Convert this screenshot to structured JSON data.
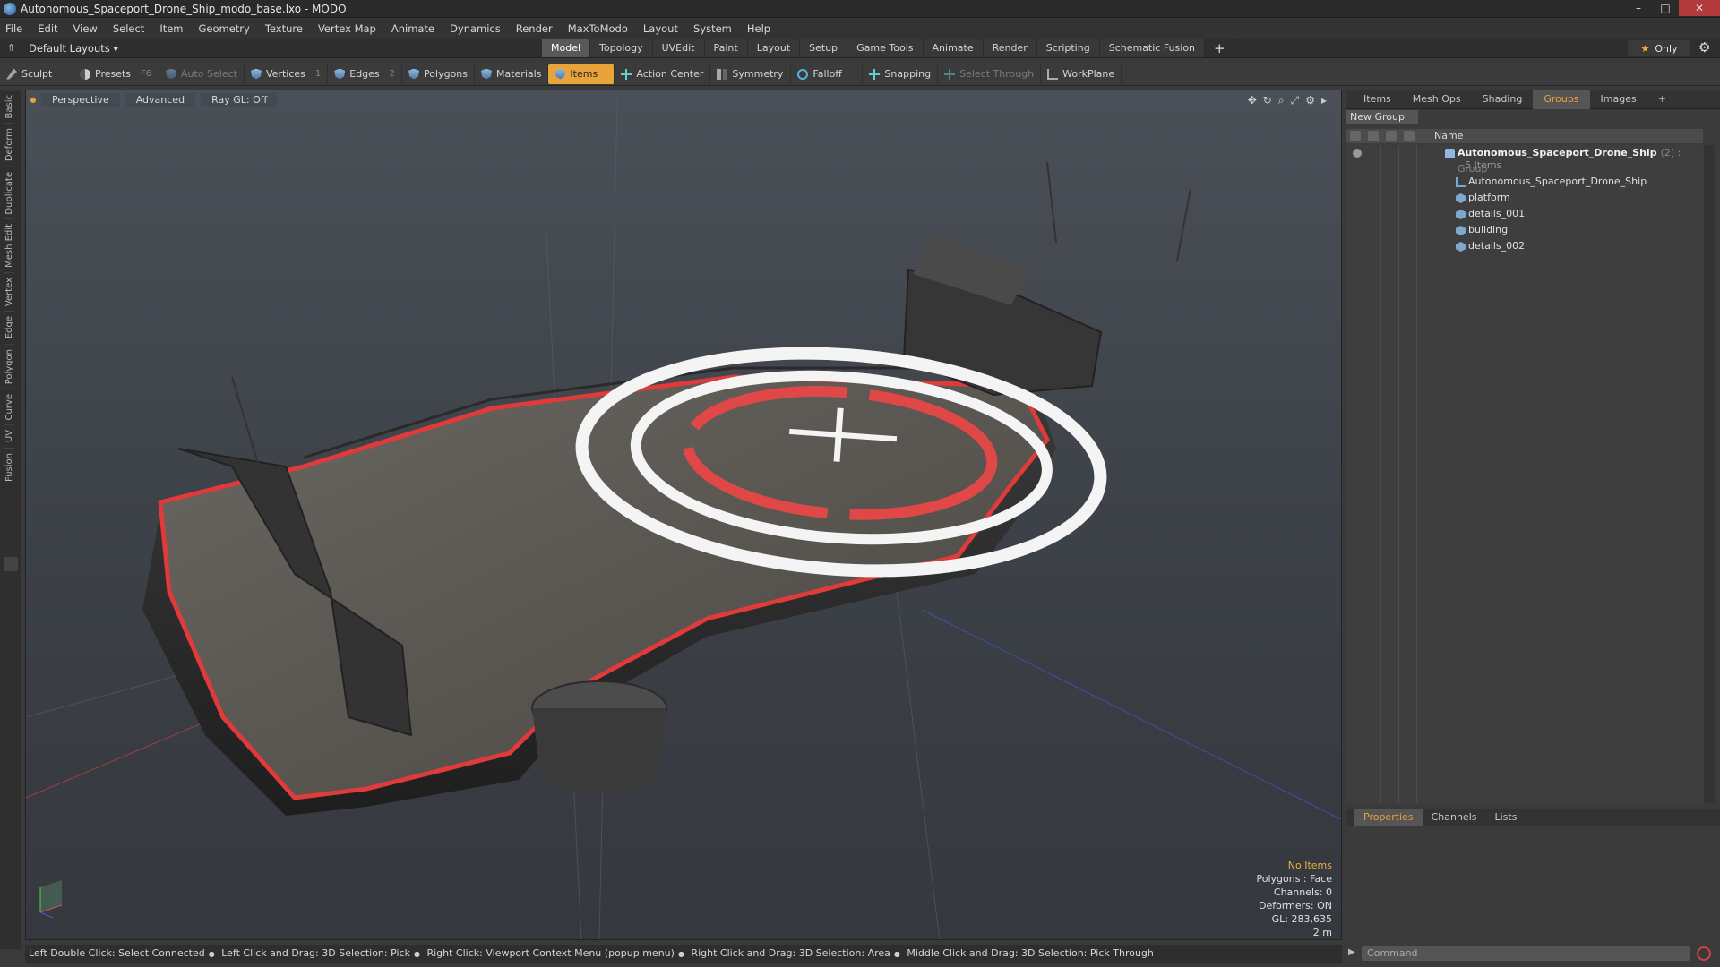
{
  "window": {
    "title": "Autonomous_Spaceport_Drone_Ship_modo_base.lxo - MODO",
    "controls": [
      "–",
      "□",
      "✕"
    ]
  },
  "menu": [
    "File",
    "Edit",
    "View",
    "Select",
    "Item",
    "Geometry",
    "Texture",
    "Vertex Map",
    "Animate",
    "Dynamics",
    "Render",
    "MaxToModo",
    "Layout",
    "System",
    "Help"
  ],
  "layoutbar": {
    "layout_select": "Default Layouts ▾",
    "tabs": [
      "Model",
      "Topology",
      "UVEdit",
      "Paint",
      "Layout",
      "Setup",
      "Game Tools",
      "Animate",
      "Render",
      "Scripting",
      "Schematic Fusion"
    ],
    "active_tab": "Model",
    "only_label": "Only"
  },
  "toolbar": {
    "sculpt": "Sculpt",
    "presets": "Presets",
    "presets_key": "F6",
    "auto_select": "Auto Select",
    "vertices": "Vertices",
    "vertices_key": "1",
    "edges": "Edges",
    "edges_key": "2",
    "polygons": "Polygons",
    "materials": "Materials",
    "items": "Items",
    "action_center": "Action Center",
    "symmetry": "Symmetry",
    "falloff": "Falloff",
    "snapping": "Snapping",
    "select_through": "Select Through",
    "workplane": "WorkPlane"
  },
  "left_tabs": [
    "Basic",
    "Deform",
    "Duplicate",
    "Mesh Edit",
    "Vertex",
    "Edge",
    "Polygon",
    "Curve",
    "UV",
    "Fusion"
  ],
  "viewport": {
    "view_mode": "Perspective",
    "shading": "Advanced",
    "raygl": "Ray GL: Off",
    "info": {
      "selection": "No Items",
      "polygons": "Polygons : Face",
      "channels": "Channels: 0",
      "deformers": "Deformers: ON",
      "gl": "GL: 283,635",
      "scale": "2 m"
    }
  },
  "statusbar": [
    "Left Double Click: Select Connected",
    "Left Click and Drag: 3D Selection: Pick",
    "Right Click: Viewport Context Menu (popup menu)",
    "Right Click and Drag: 3D Selection: Area",
    "Middle Click and Drag: 3D Selection: Pick Through"
  ],
  "right_panel": {
    "tabs": [
      "Items",
      "Mesh Ops",
      "Shading",
      "Groups",
      "Images"
    ],
    "active_tab": "Groups",
    "new_group": "New Group",
    "column_name": "Name",
    "group": {
      "name": "Autonomous_Spaceport_Drone_Ship",
      "count": "(2) : Group",
      "items_label": "5 Items"
    },
    "children": [
      "Autonomous_Spaceport_Drone_Ship",
      "platform",
      "details_001",
      "building",
      "details_002"
    ]
  },
  "properties_panel": {
    "tabs": [
      "Properties",
      "Channels",
      "Lists"
    ],
    "active_tab": "Properties"
  },
  "command": {
    "placeholder": "Command"
  }
}
